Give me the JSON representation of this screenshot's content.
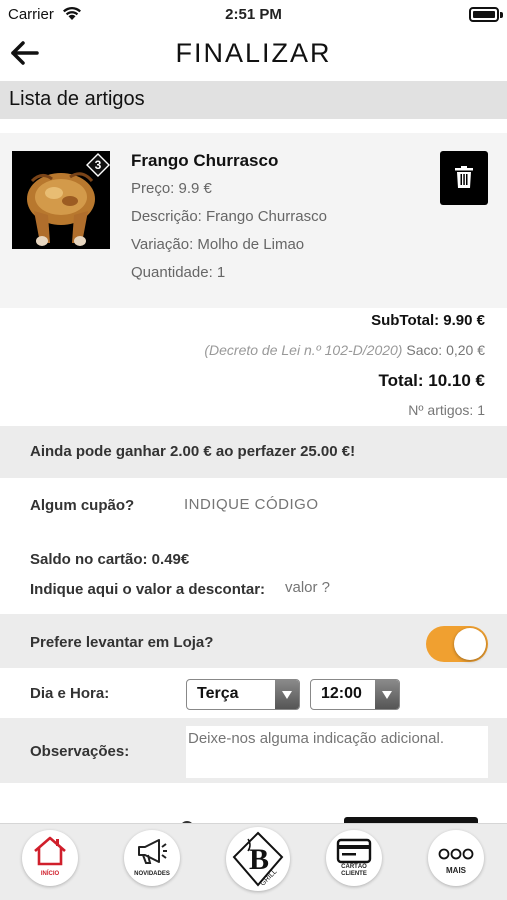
{
  "status_bar": {
    "carrier": "Carrier",
    "time": "2:51 PM"
  },
  "header": {
    "title": "FINALIZAR"
  },
  "section": {
    "title": "Lista de artigos"
  },
  "product": {
    "name": "Frango Churrasco",
    "price": "Preço: 9.9 €",
    "description": "Descrição: Frango Churrasco",
    "variation": "Variação: Molho de Limao",
    "quantity": "Quantidade: 1",
    "badge": "3"
  },
  "totals": {
    "subtotal": "SubTotal: 9.90 €",
    "bag_law": "(Decreto de Lei n.º 102-D/2020)",
    "bag": "Saco: 0,20 €",
    "total": "Total: 10.10 €",
    "items_count": "Nº artigos: 1"
  },
  "promo": {
    "text": "Ainda pode ganhar 2.00 € ao perfazer 25.00 €!"
  },
  "coupon": {
    "label": "Algum cupão?",
    "placeholder": "INDIQUE CÓDIGO"
  },
  "card": {
    "balance": "Saldo no cartão: 0.49€",
    "discount_label": "Indique aqui o valor a descontar:",
    "discount_placeholder": "valor ?"
  },
  "pickup": {
    "label": "Prefere levantar em Loja?",
    "enabled": true,
    "toggle_color": "#f0a030"
  },
  "datetime": {
    "label": "Dia e Hora:",
    "day": "Terça",
    "hour": "12:00"
  },
  "notes": {
    "label": "Observações:",
    "placeholder": "Deixe-nos alguma indicação adicional."
  },
  "tab_bar": {
    "tabs": [
      {
        "label": "INÍCIO",
        "icon": "home-icon",
        "active": true
      },
      {
        "label": "NOVIDADES",
        "icon": "megaphone-icon"
      },
      {
        "label": "GRILL",
        "icon": "grill-logo-icon"
      },
      {
        "label": "CARTÃO CLIENTE",
        "label_line1": "CARTÃO",
        "label_line2": "CLIENTE",
        "icon": "card-icon"
      },
      {
        "label": "MAIS",
        "icon": "more-icon"
      }
    ],
    "accent": "#d01f2b"
  }
}
